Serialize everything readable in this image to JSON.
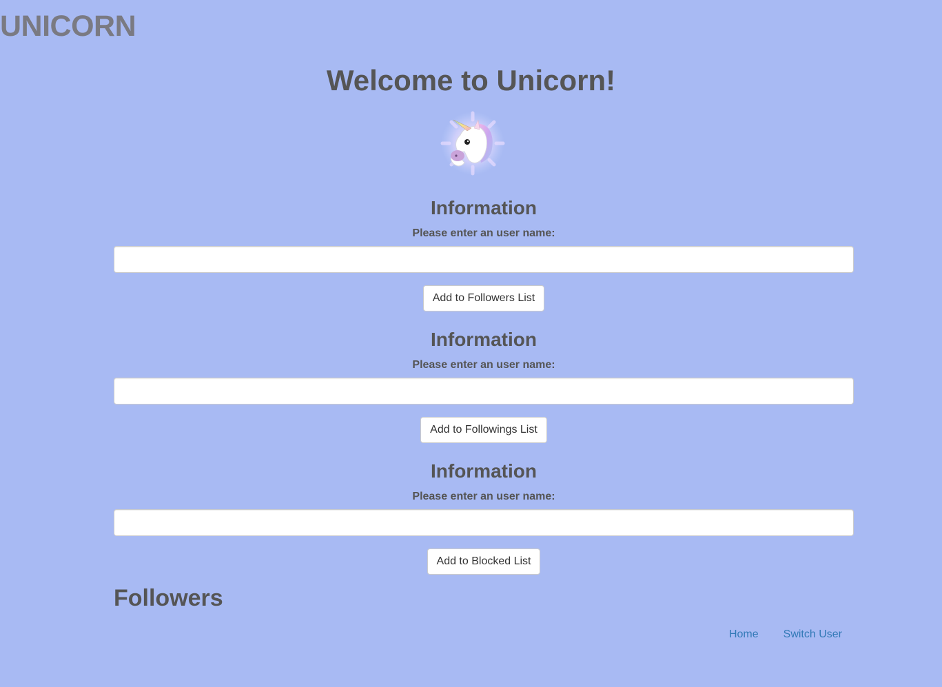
{
  "header": {
    "brand": "UNICORN",
    "welcome": "Welcome to Unicorn!",
    "logo_icon": "unicorn-face-icon"
  },
  "sections": [
    {
      "heading": "Information",
      "label": "Please enter an user name:",
      "input_value": "",
      "button_label": "Add to Followers List"
    },
    {
      "heading": "Information",
      "label": "Please enter an user name:",
      "input_value": "",
      "button_label": "Add to Followings List"
    },
    {
      "heading": "Information",
      "label": "Please enter an user name:",
      "input_value": "",
      "button_label": "Add to Blocked List"
    }
  ],
  "followers_heading": "Followers",
  "nav": {
    "home": "Home",
    "switch_user": "Switch User"
  },
  "colors": {
    "background": "#a8baf3",
    "link": "#337ab7",
    "heading": "#555555",
    "brand": "#7a7a82"
  }
}
